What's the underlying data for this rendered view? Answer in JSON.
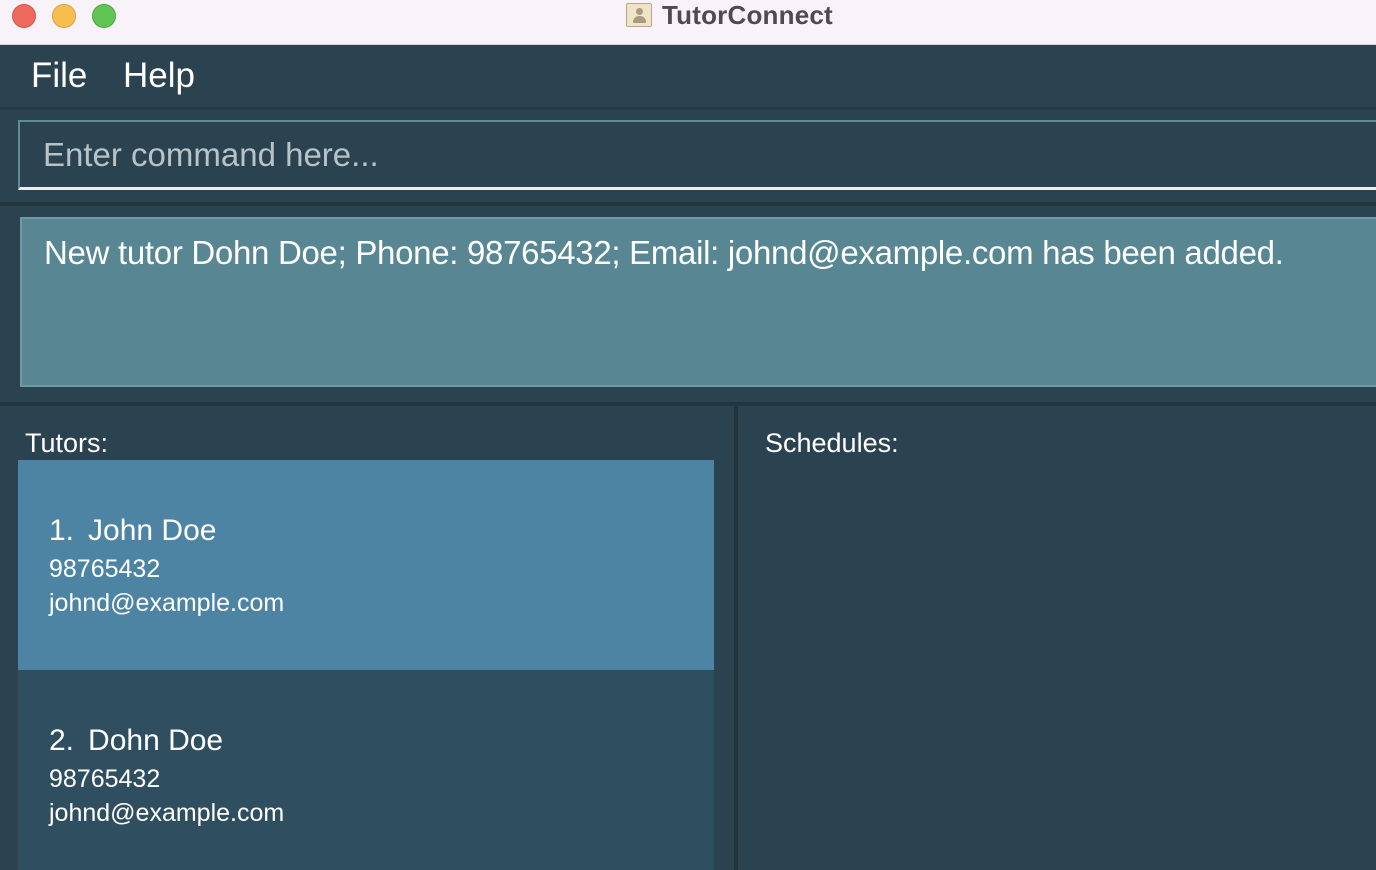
{
  "window": {
    "title": "TutorConnect"
  },
  "menu": {
    "items": [
      "File",
      "Help"
    ]
  },
  "command": {
    "placeholder": "Enter command here...",
    "value": ""
  },
  "result": {
    "message": "New tutor Dohn Doe; Phone: 98765432; Email: johnd@example.com has been added."
  },
  "tutors": {
    "label": "Tutors:",
    "items": [
      {
        "index": "1.",
        "name": "John Doe",
        "phone": "98765432",
        "email": "johnd@example.com",
        "selected": true
      },
      {
        "index": "2.",
        "name": "Dohn Doe",
        "phone": "98765432",
        "email": "johnd@example.com",
        "selected": false
      }
    ]
  },
  "schedules": {
    "label": "Schedules:",
    "items": []
  },
  "colors": {
    "background": "#2b4250",
    "result_box": "#588793",
    "selected_card": "#4d84a3",
    "card": "#2f4f61",
    "titlebar": "#f7f3f8"
  },
  "icons": {
    "app": "contact-card-icon",
    "window_controls": [
      "close-light",
      "minimize-light",
      "zoom-light"
    ]
  }
}
